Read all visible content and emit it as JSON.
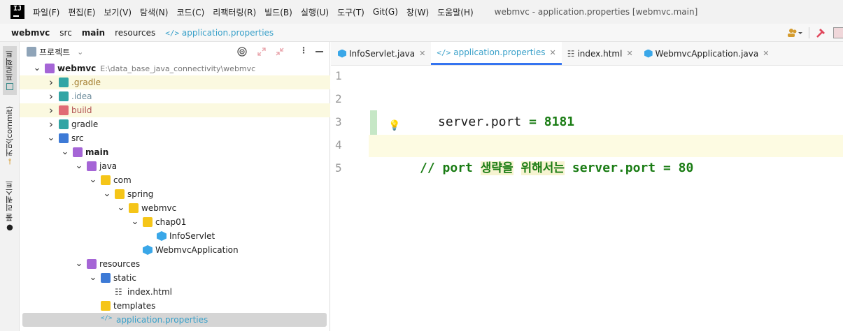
{
  "menubar": {
    "items": [
      "파일(F)",
      "편집(E)",
      "보기(V)",
      "탐색(N)",
      "코드(C)",
      "리팩터링(R)",
      "빌드(B)",
      "실행(U)",
      "도구(T)",
      "Git(G)",
      "창(W)",
      "도움말(H)"
    ],
    "window_title": "webmvc - application.properties [webmvc.main]"
  },
  "breadcrumb": [
    "webmvc",
    "src",
    "main",
    "resources",
    "application.properties"
  ],
  "left_strip": {
    "project_tab": "프로젝트",
    "commit_tab": "커밋(commit)",
    "pull_tab": "풀 리퀘스트"
  },
  "project_panel": {
    "title": "프로젝트",
    "tree": [
      {
        "label": "webmvc",
        "path": "E:\\data_base_java_connectivity\\webmvc",
        "depth": 0,
        "expanded": true,
        "icon": "module-folder"
      },
      {
        "label": ".gradle",
        "depth": 1,
        "expanded": false,
        "icon": "folder-teal",
        "style": "gold"
      },
      {
        "label": ".idea",
        "depth": 1,
        "expanded": false,
        "icon": "folder-teal",
        "style": "muted"
      },
      {
        "label": "build",
        "depth": 1,
        "expanded": false,
        "icon": "folder-red",
        "style": "red"
      },
      {
        "label": "gradle",
        "depth": 1,
        "expanded": false,
        "icon": "folder-teal"
      },
      {
        "label": "src",
        "depth": 1,
        "expanded": true,
        "icon": "folder-blue"
      },
      {
        "label": "main",
        "depth": 2,
        "expanded": true,
        "icon": "folder-purple",
        "bold": true
      },
      {
        "label": "java",
        "depth": 3,
        "expanded": true,
        "icon": "folder-purple"
      },
      {
        "label": "com",
        "depth": 4,
        "expanded": true,
        "icon": "folder"
      },
      {
        "label": "spring",
        "depth": 5,
        "expanded": true,
        "icon": "folder"
      },
      {
        "label": "webmvc",
        "depth": 6,
        "expanded": true,
        "icon": "folder"
      },
      {
        "label": "chap01",
        "depth": 7,
        "expanded": true,
        "icon": "folder"
      },
      {
        "label": "InfoServlet",
        "depth": 8,
        "icon": "class"
      },
      {
        "label": "WebmvcApplication",
        "depth": 7,
        "icon": "class",
        "leaf": true
      },
      {
        "label": "resources",
        "depth": 3,
        "expanded": true,
        "icon": "folder-purple"
      },
      {
        "label": "static",
        "depth": 4,
        "expanded": true,
        "icon": "folder-blue"
      },
      {
        "label": "index.html",
        "depth": 5,
        "icon": "html",
        "leaf": true
      },
      {
        "label": "templates",
        "depth": 4,
        "icon": "folder",
        "leaf": true
      },
      {
        "label": "application.properties",
        "depth": 4,
        "icon": "properties",
        "leaf": true,
        "selected": true,
        "style": "file"
      }
    ]
  },
  "editor": {
    "tabs": [
      {
        "label": "InfoServlet.java",
        "icon": "class-icon"
      },
      {
        "label": "application.properties",
        "icon": "properties-icon",
        "active": true
      },
      {
        "label": "index.html",
        "icon": "html-icon"
      },
      {
        "label": "WebmvcApplication.java",
        "icon": "class-icon"
      }
    ],
    "line_numbers": [
      "1",
      "2",
      "3",
      "4",
      "5"
    ],
    "line2": {
      "key": "server.port",
      "eq": " = ",
      "value": "8181"
    },
    "line4": {
      "prefix": "// port ",
      "w1": "생략을",
      "w2": "위해서는",
      "rest": " server.port = 80"
    }
  },
  "colors": {
    "accent": "#3574f0",
    "code_green": "#1a7c14",
    "file_blue": "#39a0c9"
  }
}
